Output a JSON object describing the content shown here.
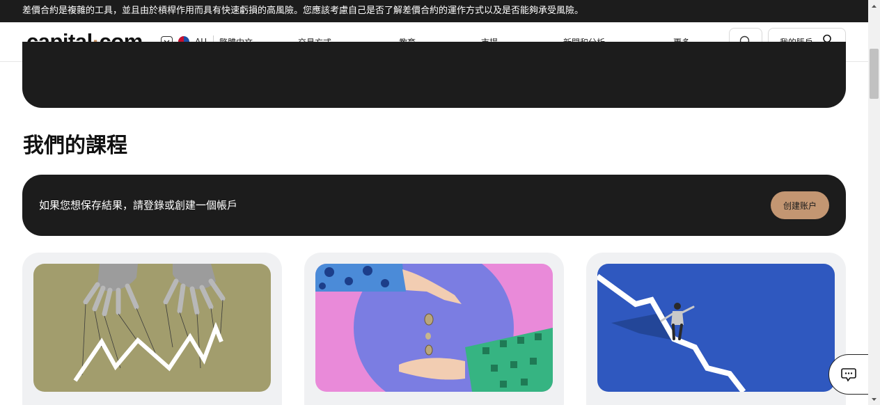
{
  "risk_banner": "差價合約是複雜的工具，並且由於槓桿作用而具有快速虧損的高風險。您應該考慮自己是否了解差價合約的運作方式以及是否能夠承受風險。",
  "header": {
    "logo_prefix": "capital",
    "logo_dot": "·",
    "logo_suffix": "com",
    "region_code": "AU",
    "language": "繁體中文",
    "nav": [
      "交易方式",
      "教育",
      "市場",
      "新聞和分析",
      "更多"
    ],
    "account_label": "我的賬戶"
  },
  "courses": {
    "title": "我們的課程",
    "login_prompt": "如果您想保存結果，請登錄或創建一個帳戶",
    "create_account": "创建账户"
  },
  "colors": {
    "dark": "#1c1c1c",
    "accent": "#c39672",
    "card_bg": "#f0f1f3"
  },
  "icons": [
    "chevron-down-icon",
    "au-flag-icon",
    "search-icon",
    "user-icon",
    "chat-icon"
  ]
}
